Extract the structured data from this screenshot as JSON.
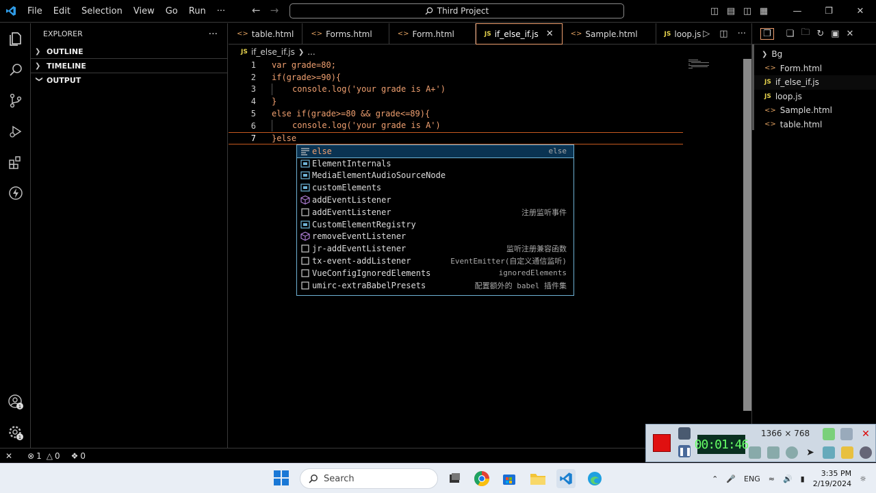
{
  "titlebar": {
    "menu": [
      "File",
      "Edit",
      "Selection",
      "View",
      "Go",
      "Run",
      "···"
    ],
    "search": "Third Project"
  },
  "sidebar": {
    "title": "EXPLORER",
    "more": "···",
    "sections": [
      "OUTLINE",
      "TIMELINE",
      "OUTPUT"
    ]
  },
  "tabs": [
    {
      "label": "table.html",
      "type": "html"
    },
    {
      "label": "Forms.html",
      "type": "html"
    },
    {
      "label": "Form.html",
      "type": "html"
    },
    {
      "label": "if_else_if.js",
      "type": "js",
      "active": true
    },
    {
      "label": "Sample.html",
      "type": "html"
    },
    {
      "label": "loop.js",
      "type": "js"
    }
  ],
  "breadcrumb": {
    "file": "if_else_if.js",
    "rest": "..."
  },
  "code": {
    "line_numbers": [
      "1",
      "2",
      "3",
      "4",
      "5",
      "6",
      "7"
    ],
    "l1": "var grade=80;",
    "l2": "if(grade>=90){",
    "l3": "console.log('your grade is A+')",
    "l4": "}",
    "l5": "else if(grade>=80 && grade<=89){",
    "l6": "console.log('your grade is A')",
    "l7": "}else"
  },
  "suggestions": [
    {
      "label": "else",
      "detail": "else",
      "icon": "snippet"
    },
    {
      "label": "ElementInternals",
      "detail": "",
      "icon": "variable"
    },
    {
      "label": "MediaElementAudioSourceNode",
      "detail": "",
      "icon": "variable"
    },
    {
      "label": "customElements",
      "detail": "",
      "icon": "variable"
    },
    {
      "label": "addEventListener",
      "detail": "",
      "icon": "method"
    },
    {
      "label": "addEventListener",
      "detail": "注册监听事件",
      "icon": "snippet-box"
    },
    {
      "label": "CustomElementRegistry",
      "detail": "",
      "icon": "variable"
    },
    {
      "label": "removeEventListener",
      "detail": "",
      "icon": "method"
    },
    {
      "label": "jr-addEventListener",
      "detail": "监听注册兼容函数",
      "icon": "snippet-box"
    },
    {
      "label": "tx-event-addListener",
      "detail": "EventEmitter(自定义通信监听)",
      "icon": "snippet-box"
    },
    {
      "label": "VueConfigIgnoredElements",
      "detail": "ignoredElements",
      "icon": "snippet-box"
    },
    {
      "label": "umirc-extraBabelPresets",
      "detail": "配置额外的 babel 插件集",
      "icon": "snippet-box"
    }
  ],
  "right_pane": {
    "items": [
      {
        "label": "Bg",
        "type": "folder"
      },
      {
        "label": "Form.html",
        "type": "html"
      },
      {
        "label": "if_else_if.js",
        "type": "js",
        "active": true
      },
      {
        "label": "loop.js",
        "type": "js"
      },
      {
        "label": "Sample.html",
        "type": "html"
      },
      {
        "label": "table.html",
        "type": "html"
      }
    ]
  },
  "statusbar": {
    "errors": "1",
    "warnings": "0",
    "ports": "0"
  },
  "recorder": {
    "time": "00:01:46",
    "resolution": "1366 × 768"
  },
  "taskbar": {
    "search_placeholder": "Search",
    "lang": "ENG",
    "time": "3:35 PM",
    "date": "2/19/2024"
  },
  "colors": {
    "accent": "#f0a070",
    "suggest_border": "#6fb3d6",
    "js_icon": "#e8d44d"
  }
}
